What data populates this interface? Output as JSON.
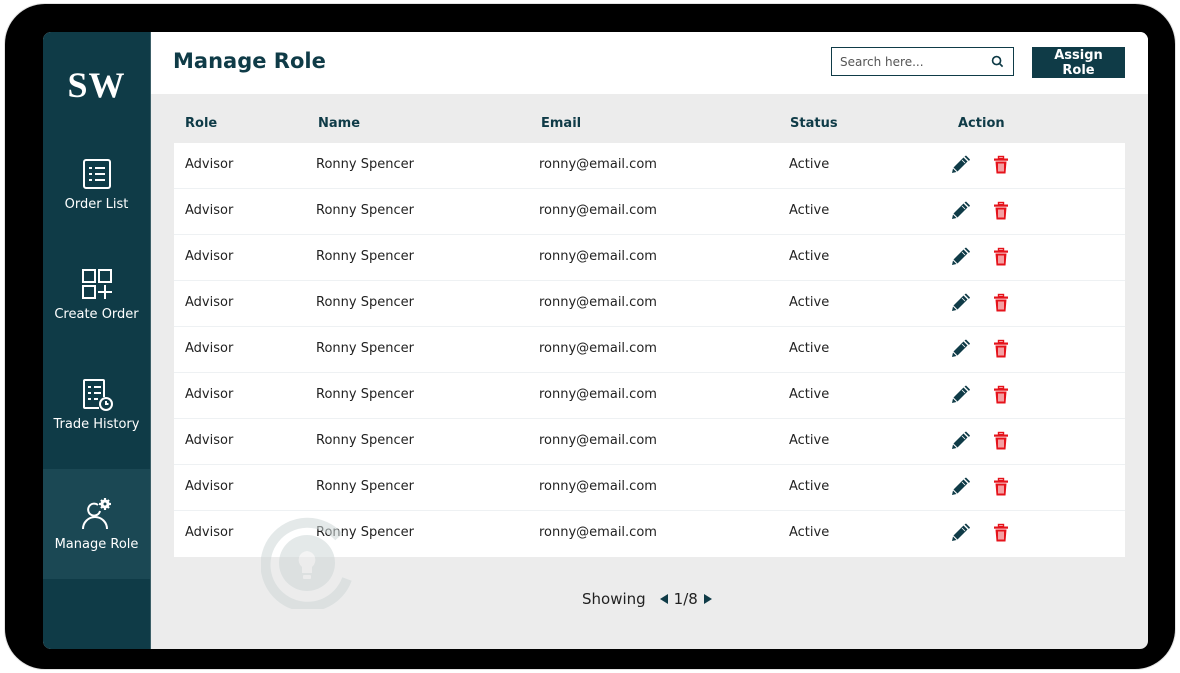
{
  "app": {
    "logo": "SW"
  },
  "sidebar": {
    "items": [
      {
        "label": "Order List",
        "icon": "list-icon",
        "active": false
      },
      {
        "label": "Create Order",
        "icon": "grid-plus-icon",
        "active": false
      },
      {
        "label": "Trade History",
        "icon": "list-clock-icon",
        "active": false
      },
      {
        "label": "Manage Role",
        "icon": "user-gear-icon",
        "active": true
      }
    ]
  },
  "header": {
    "title": "Manage Role",
    "search": {
      "placeholder": "Search here...",
      "value": ""
    },
    "assign_button": "Assign  Role"
  },
  "table": {
    "columns": [
      "Role",
      "Name",
      "Email",
      "Status",
      "Action"
    ],
    "rows": [
      {
        "role": "Advisor",
        "name": "Ronny Spencer",
        "email": "ronny@email.com",
        "status": "Active"
      },
      {
        "role": "Advisor",
        "name": "Ronny Spencer",
        "email": "ronny@email.com",
        "status": "Active"
      },
      {
        "role": "Advisor",
        "name": "Ronny Spencer",
        "email": "ronny@email.com",
        "status": "Active"
      },
      {
        "role": "Advisor",
        "name": "Ronny Spencer",
        "email": "ronny@email.com",
        "status": "Active"
      },
      {
        "role": "Advisor",
        "name": "Ronny Spencer",
        "email": "ronny@email.com",
        "status": "Active"
      },
      {
        "role": "Advisor",
        "name": "Ronny Spencer",
        "email": "ronny@email.com",
        "status": "Active"
      },
      {
        "role": "Advisor",
        "name": "Ronny Spencer",
        "email": "ronny@email.com",
        "status": "Active"
      },
      {
        "role": "Advisor",
        "name": "Ronny Spencer",
        "email": "ronny@email.com",
        "status": "Active"
      },
      {
        "role": "Advisor",
        "name": "Ronny Spencer",
        "email": "ronny@email.com",
        "status": "Active"
      }
    ]
  },
  "pagination": {
    "label": "Showing",
    "page": "1/8"
  },
  "colors": {
    "primary": "#0f3b47",
    "delete": "#e5131b",
    "background": "#ececec"
  }
}
